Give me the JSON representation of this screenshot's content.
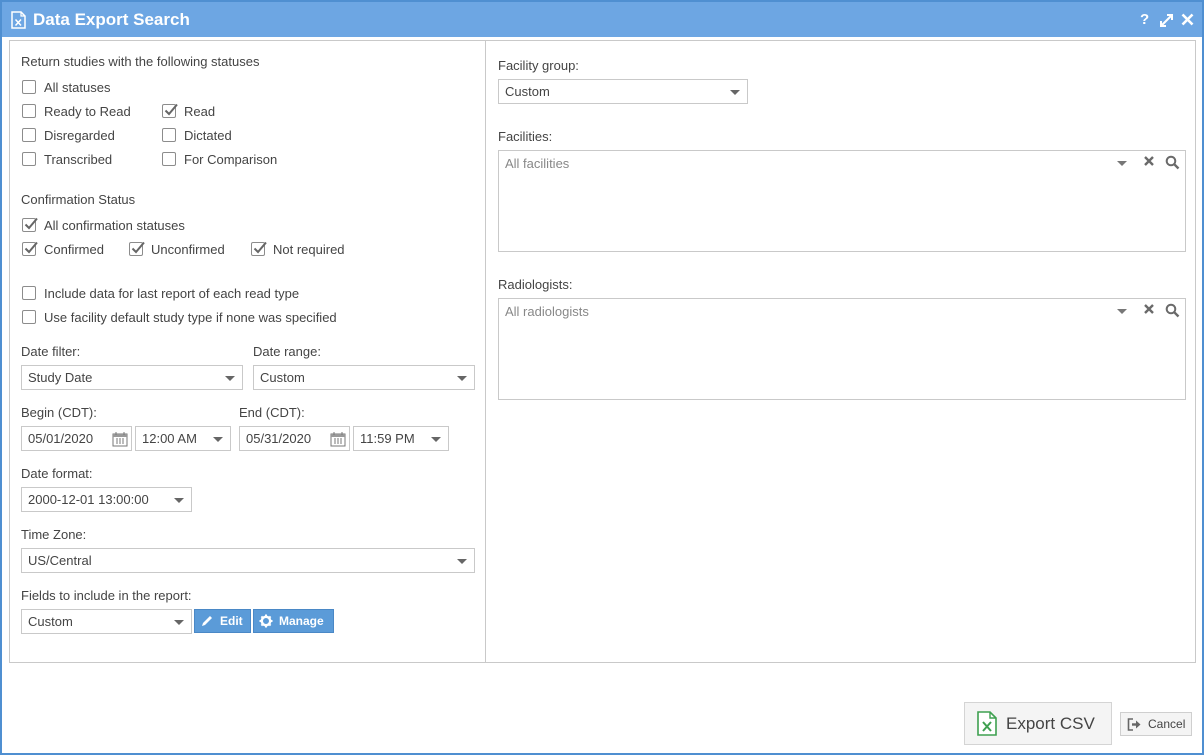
{
  "window": {
    "title": "Data Export Search",
    "help_label": "?",
    "icons": [
      "document-excel-icon",
      "help-icon",
      "maximize-icon",
      "close-icon"
    ]
  },
  "left": {
    "statuses_heading": "Return studies with the following statuses",
    "statuses": {
      "all": {
        "label": "All statuses",
        "checked": false
      },
      "ready_to_read": {
        "label": "Ready to Read",
        "checked": false
      },
      "read": {
        "label": "Read",
        "checked": true
      },
      "disregarded": {
        "label": "Disregarded",
        "checked": false
      },
      "dictated": {
        "label": "Dictated",
        "checked": false
      },
      "transcribed": {
        "label": "Transcribed",
        "checked": false
      },
      "for_comparison": {
        "label": "For Comparison",
        "checked": false
      }
    },
    "confirmation_heading": "Confirmation Status",
    "confirmation": {
      "all": {
        "label": "All confirmation statuses",
        "checked": true
      },
      "confirmed": {
        "label": "Confirmed",
        "checked": true
      },
      "unconfirmed": {
        "label": "Unconfirmed",
        "checked": true
      },
      "not_required": {
        "label": "Not required",
        "checked": true
      }
    },
    "options": {
      "last_report": {
        "label": "Include data for last report of each read type",
        "checked": false
      },
      "facility_default": {
        "label": "Use facility default study type if none was specified",
        "checked": false
      }
    },
    "date_filter": {
      "label": "Date filter:",
      "value": "Study Date"
    },
    "date_range": {
      "label": "Date range:",
      "value": "Custom"
    },
    "begin": {
      "label": "Begin (CDT):",
      "date": "05/01/2020",
      "time": "12:00 AM"
    },
    "end": {
      "label": "End (CDT):",
      "date": "05/31/2020",
      "time": "11:59 PM"
    },
    "date_format": {
      "label": "Date format:",
      "value": "2000-12-01 13:00:00"
    },
    "time_zone": {
      "label": "Time Zone:",
      "value": "US/Central"
    },
    "fields": {
      "label": "Fields to include in the report:",
      "value": "Custom",
      "edit_label": "Edit",
      "manage_label": "Manage"
    }
  },
  "right": {
    "facility_group": {
      "label": "Facility group:",
      "value": "Custom"
    },
    "facilities": {
      "label": "Facilities:",
      "placeholder": "All facilities"
    },
    "radiologists": {
      "label": "Radiologists:",
      "placeholder": "All radiologists"
    }
  },
  "footer": {
    "export_label": "Export CSV",
    "cancel_label": "Cancel"
  },
  "colors": {
    "titlebar": "#6da6e3",
    "button_blue": "#5b9bd8",
    "excel_green": "#3ea050"
  }
}
